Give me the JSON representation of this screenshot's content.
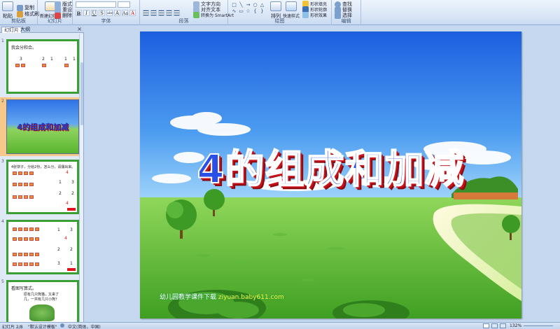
{
  "ribbon": {
    "groups": [
      {
        "label": "剪贴板",
        "buttons": [
          "粘贴",
          "复制",
          "格式刷"
        ]
      },
      {
        "label": "幻灯片",
        "buttons": [
          "新建幻灯片",
          "版式",
          "重设",
          "删除"
        ]
      },
      {
        "label": "字体",
        "buttons": []
      },
      {
        "label": "段落",
        "buttons": [
          "文字方向",
          "对齐文本",
          "转换为 SmartArt"
        ]
      },
      {
        "label": "绘图",
        "buttons": [
          "排列",
          "快速样式",
          "形状填充",
          "形状轮廓",
          "形状效果"
        ]
      },
      {
        "label": "编辑",
        "buttons": [
          "查找",
          "替换",
          "选择"
        ]
      }
    ],
    "font_format": [
      "B",
      "I",
      "U",
      "S",
      "abc",
      "A",
      "Aa",
      "A"
    ]
  },
  "panel": {
    "tabs": [
      "幻灯片",
      "大纲"
    ],
    "close": "×",
    "slides": [
      {
        "number": "1",
        "title": "我会分和合。",
        "numbers": [
          "3",
          "2",
          "1",
          "1",
          "1"
        ]
      },
      {
        "number": "2",
        "title": "4的组成和加减"
      },
      {
        "number": "3",
        "title": "4张饼子，分给2份，怎么分，请摆出来。",
        "numbers": [
          "4",
          "1",
          "3",
          "2",
          "2",
          "4"
        ]
      },
      {
        "number": "4",
        "title": "",
        "numbers": [
          "1",
          "3",
          "4",
          "2",
          "2",
          "3",
          "1"
        ]
      },
      {
        "number": "5",
        "title": "看图写算式。",
        "lines": [
          "原有几只熊猫，又来了",
          "几，一共有几只小熊？"
        ]
      }
    ]
  },
  "slide": {
    "title": "4的组成和加减",
    "watermark_prefix": "幼儿园教学课件下载",
    "watermark_url": "ziyuan.baby611.com"
  },
  "status": {
    "slide_count": "幻灯片 2/8",
    "theme": "\"默认设计模板\"",
    "language": "中文(简体，中国)",
    "zoom": "132%"
  }
}
